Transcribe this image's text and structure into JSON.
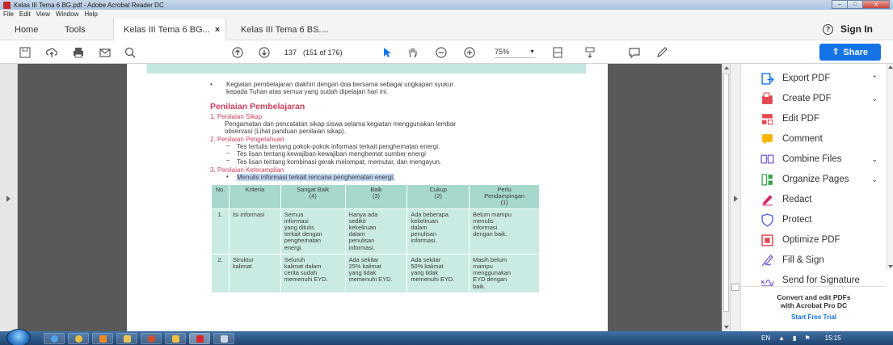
{
  "window": {
    "title": "Kelas III Tema 6 BG.pdf - Adobe Acrobat Reader DC"
  },
  "menu": [
    "File",
    "Edit",
    "View",
    "Window",
    "Help"
  ],
  "nav": {
    "home": "Home",
    "tools": "Tools",
    "tab1": "Kelas III Tema 6 BG...",
    "tab1_close": "×",
    "tab2": "Kelas III Tema 6 BS....",
    "sign_in": "Sign In"
  },
  "toolbar": {
    "page_number": "137",
    "page_of": "(151 of 176)",
    "zoom": "75%",
    "share_label": "Share"
  },
  "document": {
    "bullet_intro_line1": "Kegiatan pembelajaran diakhiri dengan doa bersama sebagai ungkapan syukur",
    "bullet_intro_line2": "kepada Tuhan atas semua yang sudah dipelajari hari ini.",
    "heading": "Penilaian Pembelajaran",
    "item1_title": "1.   Penilaian Sikap",
    "item1_line1": "Pengamatan dan pencatatan sikap siswa selama kegiatan menggunakan lembar",
    "item1_line2": "observasi (Lihat panduan penilaian sikap).",
    "item2_title": "2.   Penilaian Pengetahuan",
    "item2_b1": "Tes tertulis tentang pokok-pokok informasi terkait penghematan energi.",
    "item2_b2": "Tes lisan tentang kewajiban-kewajiban menghemat sumber energi",
    "item2_b3": "Tes lisan tentang kombinasi gerak melompat, memutar, dan mengayun.",
    "item3_title": "3.   Penilaian Keterampilan",
    "item3_b1": "Menulis informasi terkait rencana penghematan energi.",
    "table": {
      "headers": [
        "No.",
        "Kriteria",
        "Sangat Baik\n(4)",
        "Baik\n(3)",
        "Cukup\n(2)",
        "Perlu\nPendampingan\n(1)"
      ],
      "rows": [
        [
          "1.",
          "Isi informasi",
          "Semua\ninformasi\nyang ditulis\nterkait dengan\npenghematan\nenergi.",
          "Hanya ada\nsedikit\nkekeliruan\ndalam\npenulisan\ninformasi.",
          "Ada beberapa\nkekeliruan\ndalam\npenulisan\ninformasi.",
          "Belum mampu\nmenulis\ninformasi\ndengan baik."
        ],
        [
          "2.",
          "Struktur\nkalimat",
          "Seluruh\nkalimat dalam\ncerita sudah\nmemenuhi EYD.",
          "Ada sekitar\n25% kalimat\nyang tidak\nmemenuhi EYD.",
          "Ada sekitar\n50% kalimat\nyang tidak\nmemenuhi EYD.",
          "Masih belum\nmampu\nmenggunakan\nEYD dengan\nbaik."
        ]
      ]
    }
  },
  "tools_panel": {
    "items": [
      {
        "label": "Export PDF",
        "chevron": "^"
      },
      {
        "label": "Create PDF",
        "chevron": "v"
      },
      {
        "label": "Edit PDF"
      },
      {
        "label": "Comment"
      },
      {
        "label": "Combine Files",
        "chevron": "v"
      },
      {
        "label": "Organize Pages",
        "chevron": "v"
      },
      {
        "label": "Redact"
      },
      {
        "label": "Protect"
      },
      {
        "label": "Optimize PDF"
      },
      {
        "label": "Fill & Sign"
      },
      {
        "label": "Send for Signature"
      }
    ],
    "promo_line1": "Convert and edit PDFs",
    "promo_line2": "with Acrobat Pro DC",
    "promo_link": "Start Free Trial"
  },
  "taskbar": {
    "lang": "EN",
    "clock": "15:15"
  }
}
